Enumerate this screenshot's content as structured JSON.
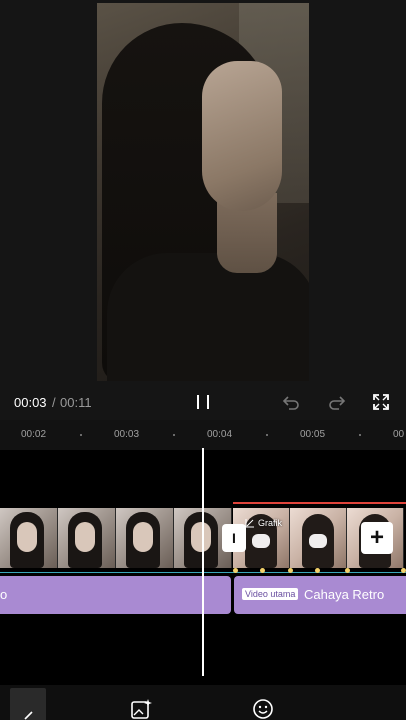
{
  "playback": {
    "time_current": "00:03",
    "time_separator": "/",
    "time_total": "00:11"
  },
  "timeline": {
    "ruler_ticks": [
      "00:02",
      "00:03",
      "00:04",
      "00:05",
      "00"
    ]
  },
  "clip_overlay": {
    "grafik_label": "Grafik",
    "transition_label": "I",
    "add_label": "+"
  },
  "effect_track": {
    "left_label": "o",
    "badge": "Video utama",
    "name": "Cahaya Retro"
  },
  "icons": {
    "pause": "pause-icon",
    "undo": "undo-icon",
    "redo": "redo-icon",
    "fullscreen": "fullscreen-icon",
    "back": "chevron-icon",
    "image_tool": "image-sparkle-icon",
    "sticker_tool": "sticker-icon"
  },
  "colors": {
    "effect_track": "#a98ad2",
    "keyframe": "#f2d16b",
    "playhead": "#ffffff",
    "selection_line": "#e0443b"
  }
}
